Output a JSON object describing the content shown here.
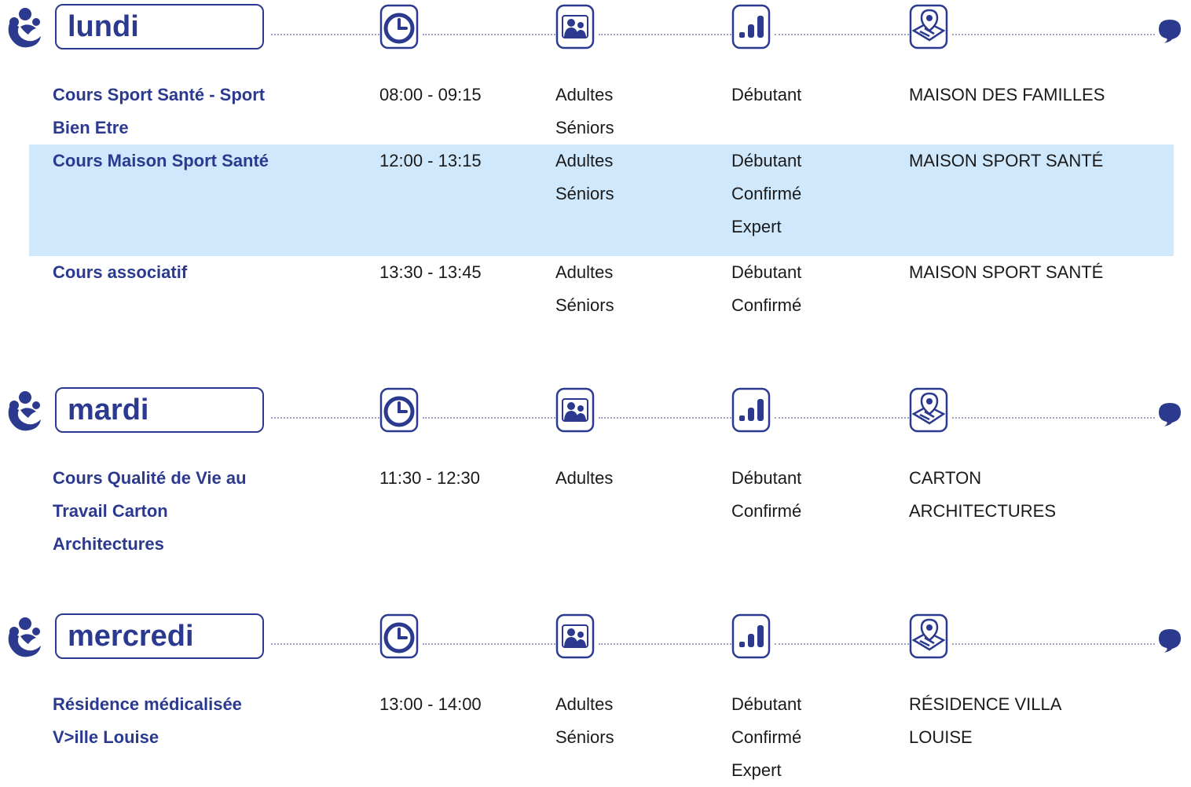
{
  "colors": {
    "primary": "#2b3a8f",
    "highlight_row": "#cfe8fb",
    "dots": "#9aa3c5"
  },
  "icons": {
    "logo": "people-logo-icon",
    "time": "clock-icon",
    "public": "group-users-icon",
    "level": "signal-bars-icon",
    "place": "map-pin-icon",
    "end": "speech-bubble-icon"
  },
  "days": [
    {
      "name": "lundi",
      "rows": [
        {
          "title": [
            "Cours Sport Santé - Sport",
            "Bien Etre"
          ],
          "time": "08:00 - 09:15",
          "public": [
            "Adultes",
            "Séniors"
          ],
          "level": [
            "Débutant"
          ],
          "place": [
            "MAISON DES FAMILLES"
          ],
          "highlight": false
        },
        {
          "title": [
            "Cours Maison Sport Santé"
          ],
          "time": "12:00 - 13:15",
          "public": [
            "Adultes",
            "Séniors"
          ],
          "level": [
            "Débutant",
            "Confirmé",
            "Expert"
          ],
          "place": [
            "MAISON SPORT SANTÉ"
          ],
          "highlight": true
        },
        {
          "title": [
            "Cours associatif"
          ],
          "time": "13:30 - 13:45",
          "public": [
            "Adultes",
            "Séniors"
          ],
          "level": [
            "Débutant",
            "Confirmé"
          ],
          "place": [
            "MAISON SPORT SANTÉ"
          ],
          "highlight": false
        }
      ]
    },
    {
      "name": "mardi",
      "rows": [
        {
          "title": [
            "Cours Qualité de Vie au",
            "Travail Carton",
            "Architectures"
          ],
          "time": "11:30 - 12:30",
          "public": [
            "Adultes"
          ],
          "level": [
            "Débutant",
            "Confirmé"
          ],
          "place": [
            "CARTON",
            "ARCHITECTURES"
          ],
          "highlight": false
        }
      ]
    },
    {
      "name": "mercredi",
      "rows": [
        {
          "title": [
            "Résidence médicalisée",
            "V>ille Louise"
          ],
          "time": "13:00 - 14:00",
          "public": [
            "Adultes",
            "Séniors"
          ],
          "level": [
            "Débutant",
            "Confirmé",
            "Expert"
          ],
          "place": [
            "RÉSIDENCE VILLA",
            "LOUISE"
          ],
          "highlight": false
        }
      ]
    }
  ]
}
